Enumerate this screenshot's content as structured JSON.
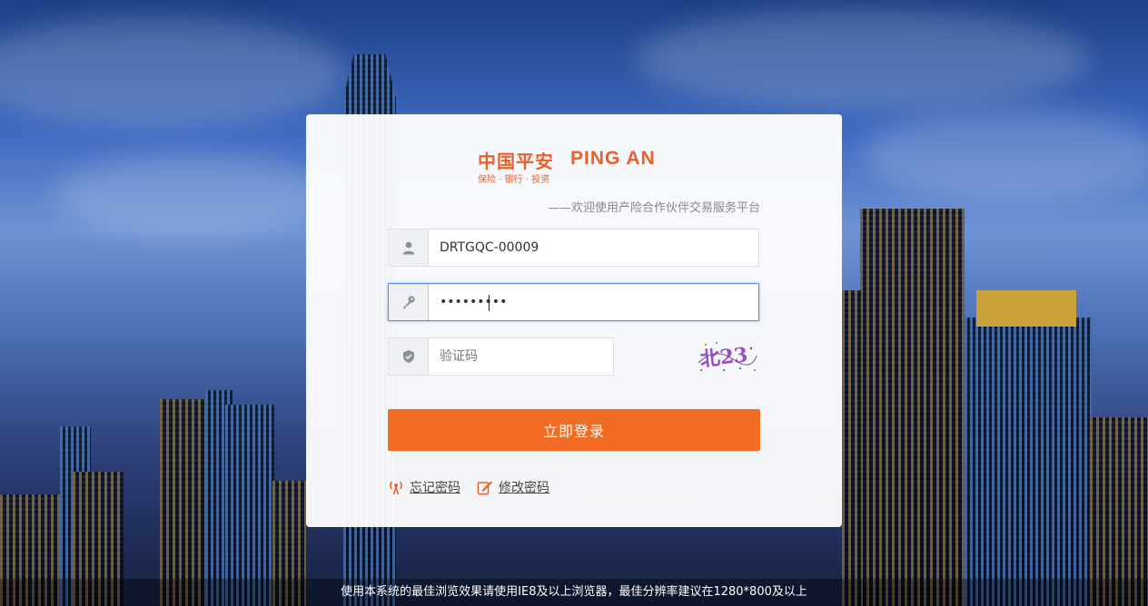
{
  "brand": {
    "logo_cn": "中国平安",
    "logo_en": "PING AN",
    "logo_sub": "保险 · 银行 · 投资",
    "accent_color": "#f26c24"
  },
  "header": {
    "subtitle": "——欢迎使用产险合作伙伴交易服务平台"
  },
  "form": {
    "username": {
      "value": "DRTGQC-00009",
      "icon": "user-icon"
    },
    "password": {
      "value": "•••••••••",
      "icon": "key-icon"
    },
    "captcha": {
      "placeholder": "验证码",
      "icon": "shield-icon",
      "image_text": "北23"
    },
    "login_label": "立即登录"
  },
  "links": {
    "forgot_password": "忘记密码",
    "change_password": "修改密码"
  },
  "footer": {
    "notice": "使用本系统的最佳浏览效果请使用IE8及以上浏览器，最佳分辨率建议在1280*800及以上"
  }
}
